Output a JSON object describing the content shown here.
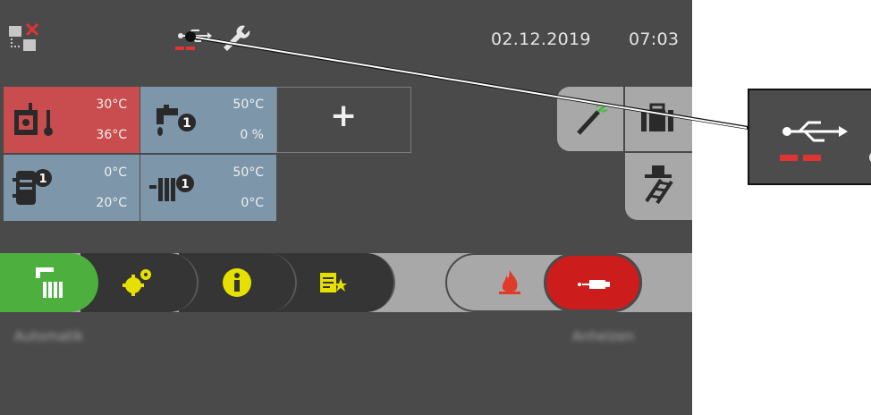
{
  "header": {
    "date": "02.12.2019",
    "time": "07:03",
    "icons": [
      "connection-error-icon",
      "usb-icon",
      "wrench-icon"
    ]
  },
  "tiles": [
    {
      "name": "boiler",
      "icon": "boiler-thermometer-icon",
      "line1": "30°C",
      "line2": "36°C",
      "color": "#c94d4f"
    },
    {
      "name": "tap-water",
      "icon": "faucet-1-icon",
      "line1": "50°C",
      "line2": "0 %",
      "color": "#7d96aa"
    },
    {
      "name": "buffer-tank",
      "icon": "tank-1-icon",
      "line1": "0°C",
      "line2": "20°C",
      "color": "#7d96aa"
    },
    {
      "name": "heating-circuit",
      "icon": "radiator-1-icon",
      "line1": "50°C",
      "line2": "0°C",
      "color": "#7d96aa"
    }
  ],
  "add_tile_label": "+",
  "nav_tabs": [
    {
      "name": "operating-mode",
      "icon": "tap-radiator-icon",
      "active": true
    },
    {
      "name": "settings",
      "icon": "gears-icon"
    },
    {
      "name": "info",
      "icon": "info-icon"
    },
    {
      "name": "favorites",
      "icon": "list-star-icon"
    }
  ],
  "right_controls": [
    {
      "name": "fire",
      "icon": "fire-icon"
    },
    {
      "name": "ignition",
      "icon": "igniter-icon",
      "active": true
    }
  ],
  "side_buttons": [
    "ash-tool-icon",
    "briefcase-icon",
    "chimney-sweep-icon"
  ],
  "status": {
    "left": "Automatik",
    "right": "Anheizen"
  },
  "colors": {
    "screen": "#4a4a4a",
    "active_green": "#4caf3e",
    "active_red": "#cc1c1c",
    "accent_yellow": "#e5e000"
  }
}
